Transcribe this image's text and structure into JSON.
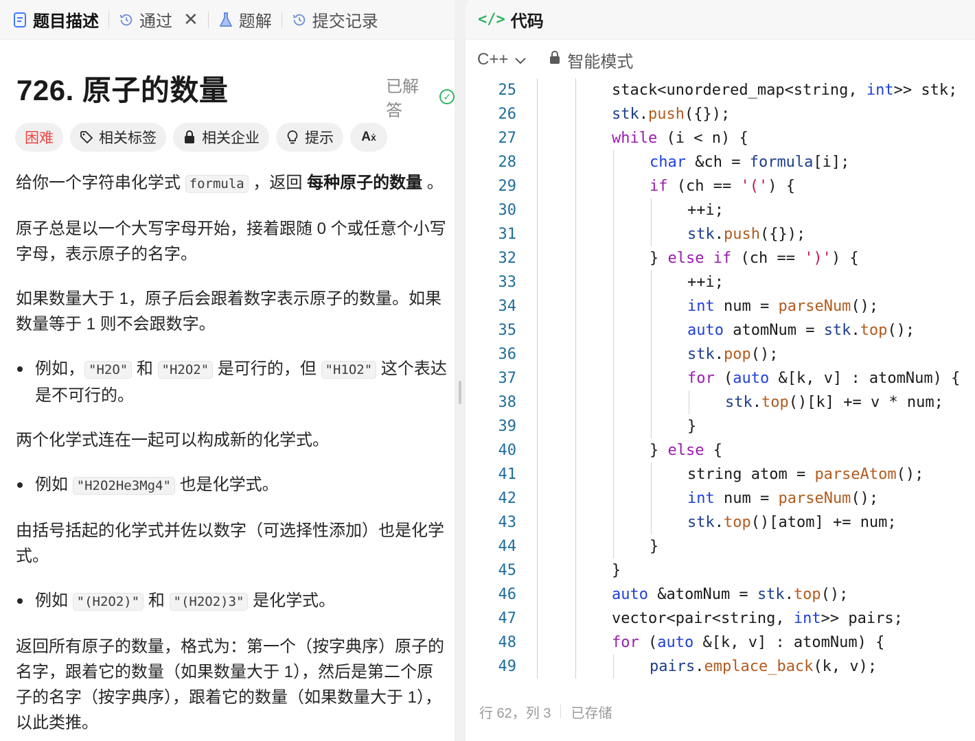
{
  "left_tabs": [
    {
      "label": "题目描述",
      "icon": "description-icon",
      "active": true
    },
    {
      "label": "通过",
      "icon": "history-icon",
      "active": false
    },
    {
      "label": "题解",
      "icon": "flask-icon",
      "active": false
    },
    {
      "label": "提交记录",
      "icon": "history-icon",
      "active": false
    }
  ],
  "problem": {
    "title": "726. 原子的数量",
    "status": "已解答",
    "tags": [
      {
        "label": "困难",
        "icon": null
      },
      {
        "label": "相关标签",
        "icon": "tag-icon"
      },
      {
        "label": "相关企业",
        "icon": "lock-icon"
      },
      {
        "label": "提示",
        "icon": "lightbulb-icon"
      },
      {
        "label": "",
        "icon": "translate-icon"
      }
    ],
    "desc": {
      "p1a": "给你一个字符串化学式 ",
      "p1_code": "formula",
      "p1b": " ，返回 ",
      "p1_bold": "每种原子的数量",
      "p1c": " 。",
      "p2": "原子总是以一个大写字母开始，接着跟随 0 个或任意个小写字母，表示原子的名字。",
      "p3": "如果数量大于 1，原子后会跟着数字表示原子的数量。如果数量等于 1 则不会跟数字。",
      "li1a": "例如，",
      "li1_c1": "\"H2O\"",
      "li1b": " 和 ",
      "li1_c2": "\"H2O2\"",
      "li1c": " 是可行的，但 ",
      "li1_c3": "\"H1O2\"",
      "li1d": " 这个表达是不可行的。",
      "p4": "两个化学式连在一起可以构成新的化学式。",
      "li2a": "例如 ",
      "li2_c1": "\"H2O2He3Mg4\"",
      "li2b": " 也是化学式。",
      "p5": "由括号括起的化学式并佐以数字（可选择性添加）也是化学式。",
      "li3a": "例如 ",
      "li3_c1": "\"(H2O2)\"",
      "li3b": " 和 ",
      "li3_c2": "\"(H2O2)3\"",
      "li3c": " 是化学式。",
      "p6": "返回所有原子的数量，格式为：第一个（按字典序）原子的名字，跟着它的数量（如果数量大于 1），然后是第二个原子的名字（按字典序），跟着它的数量（如果数量大于 1），以此类推。"
    }
  },
  "code_panel": {
    "title": "代码",
    "language": "C++",
    "mode": "智能模式"
  },
  "code_lines": [
    {
      "n": "25",
      "indent": 0,
      "segs": [
        [
          "p",
          "stack<unordered_map<string, "
        ],
        [
          "t",
          "int"
        ],
        [
          "p",
          ">> stk;"
        ]
      ]
    },
    {
      "n": "26",
      "indent": 0,
      "segs": [
        [
          "v",
          "stk"
        ],
        [
          "p",
          "."
        ],
        [
          "f",
          "push"
        ],
        [
          "p",
          "({});"
        ]
      ]
    },
    {
      "n": "27",
      "indent": 0,
      "segs": [
        [
          "k",
          "while"
        ],
        [
          "p",
          " (i < n) {"
        ]
      ]
    },
    {
      "n": "28",
      "indent": 1,
      "segs": [
        [
          "t",
          "char"
        ],
        [
          "p",
          " &ch = "
        ],
        [
          "v",
          "formula"
        ],
        [
          "p",
          "[i];"
        ]
      ]
    },
    {
      "n": "29",
      "indent": 1,
      "segs": [
        [
          "k",
          "if"
        ],
        [
          "p",
          " (ch == "
        ],
        [
          "s",
          "'('"
        ],
        [
          "p",
          ") {"
        ]
      ]
    },
    {
      "n": "30",
      "indent": 2,
      "segs": [
        [
          "p",
          "++i;"
        ]
      ]
    },
    {
      "n": "31",
      "indent": 2,
      "segs": [
        [
          "v",
          "stk"
        ],
        [
          "p",
          "."
        ],
        [
          "f",
          "push"
        ],
        [
          "p",
          "({});"
        ]
      ]
    },
    {
      "n": "32",
      "indent": 1,
      "segs": [
        [
          "p",
          "} "
        ],
        [
          "k",
          "else if"
        ],
        [
          "p",
          " (ch == "
        ],
        [
          "s",
          "')'"
        ],
        [
          "p",
          ") {"
        ]
      ]
    },
    {
      "n": "33",
      "indent": 2,
      "segs": [
        [
          "p",
          "++i;"
        ]
      ]
    },
    {
      "n": "34",
      "indent": 2,
      "segs": [
        [
          "t",
          "int"
        ],
        [
          "p",
          " num = "
        ],
        [
          "f",
          "parseNum"
        ],
        [
          "p",
          "();"
        ]
      ]
    },
    {
      "n": "35",
      "indent": 2,
      "segs": [
        [
          "t",
          "auto"
        ],
        [
          "p",
          " atomNum = "
        ],
        [
          "v",
          "stk"
        ],
        [
          "p",
          "."
        ],
        [
          "f",
          "top"
        ],
        [
          "p",
          "();"
        ]
      ]
    },
    {
      "n": "36",
      "indent": 2,
      "segs": [
        [
          "v",
          "stk"
        ],
        [
          "p",
          "."
        ],
        [
          "f",
          "pop"
        ],
        [
          "p",
          "();"
        ]
      ]
    },
    {
      "n": "37",
      "indent": 2,
      "segs": [
        [
          "k",
          "for"
        ],
        [
          "p",
          " ("
        ],
        [
          "t",
          "auto"
        ],
        [
          "p",
          " &[k, v] : atomNum) {"
        ]
      ]
    },
    {
      "n": "38",
      "indent": 3,
      "segs": [
        [
          "v",
          "stk"
        ],
        [
          "p",
          "."
        ],
        [
          "f",
          "top"
        ],
        [
          "p",
          "()[k] += v * num;"
        ]
      ]
    },
    {
      "n": "39",
      "indent": 2,
      "segs": [
        [
          "p",
          "}"
        ]
      ]
    },
    {
      "n": "40",
      "indent": 1,
      "segs": [
        [
          "p",
          "} "
        ],
        [
          "k",
          "else"
        ],
        [
          "p",
          " {"
        ]
      ]
    },
    {
      "n": "41",
      "indent": 2,
      "segs": [
        [
          "p",
          "string atom = "
        ],
        [
          "f",
          "parseAtom"
        ],
        [
          "p",
          "();"
        ]
      ]
    },
    {
      "n": "42",
      "indent": 2,
      "segs": [
        [
          "t",
          "int"
        ],
        [
          "p",
          " num = "
        ],
        [
          "f",
          "parseNum"
        ],
        [
          "p",
          "();"
        ]
      ]
    },
    {
      "n": "43",
      "indent": 2,
      "segs": [
        [
          "v",
          "stk"
        ],
        [
          "p",
          "."
        ],
        [
          "f",
          "top"
        ],
        [
          "p",
          "()[atom] += num;"
        ]
      ]
    },
    {
      "n": "44",
      "indent": 1,
      "segs": [
        [
          "p",
          "}"
        ]
      ]
    },
    {
      "n": "45",
      "indent": 0,
      "segs": [
        [
          "p",
          "}"
        ]
      ]
    },
    {
      "n": "46",
      "indent": 0,
      "segs": [
        [
          "t",
          "auto"
        ],
        [
          "p",
          " &atomNum = "
        ],
        [
          "v",
          "stk"
        ],
        [
          "p",
          "."
        ],
        [
          "f",
          "top"
        ],
        [
          "p",
          "();"
        ]
      ]
    },
    {
      "n": "47",
      "indent": 0,
      "segs": [
        [
          "p",
          "vector<pair<string, "
        ],
        [
          "t",
          "int"
        ],
        [
          "p",
          ">> pairs;"
        ]
      ]
    },
    {
      "n": "48",
      "indent": 0,
      "segs": [
        [
          "k",
          "for"
        ],
        [
          "p",
          " ("
        ],
        [
          "t",
          "auto"
        ],
        [
          "p",
          " &[k, v] : atomNum) {"
        ]
      ]
    },
    {
      "n": "49",
      "indent": 1,
      "segs": [
        [
          "v",
          "pairs"
        ],
        [
          "p",
          "."
        ],
        [
          "f",
          "emplace_back"
        ],
        [
          "p",
          "(k, v);"
        ]
      ]
    }
  ],
  "status_bar": {
    "position": "行 62，列 3",
    "saved": "已存储"
  }
}
